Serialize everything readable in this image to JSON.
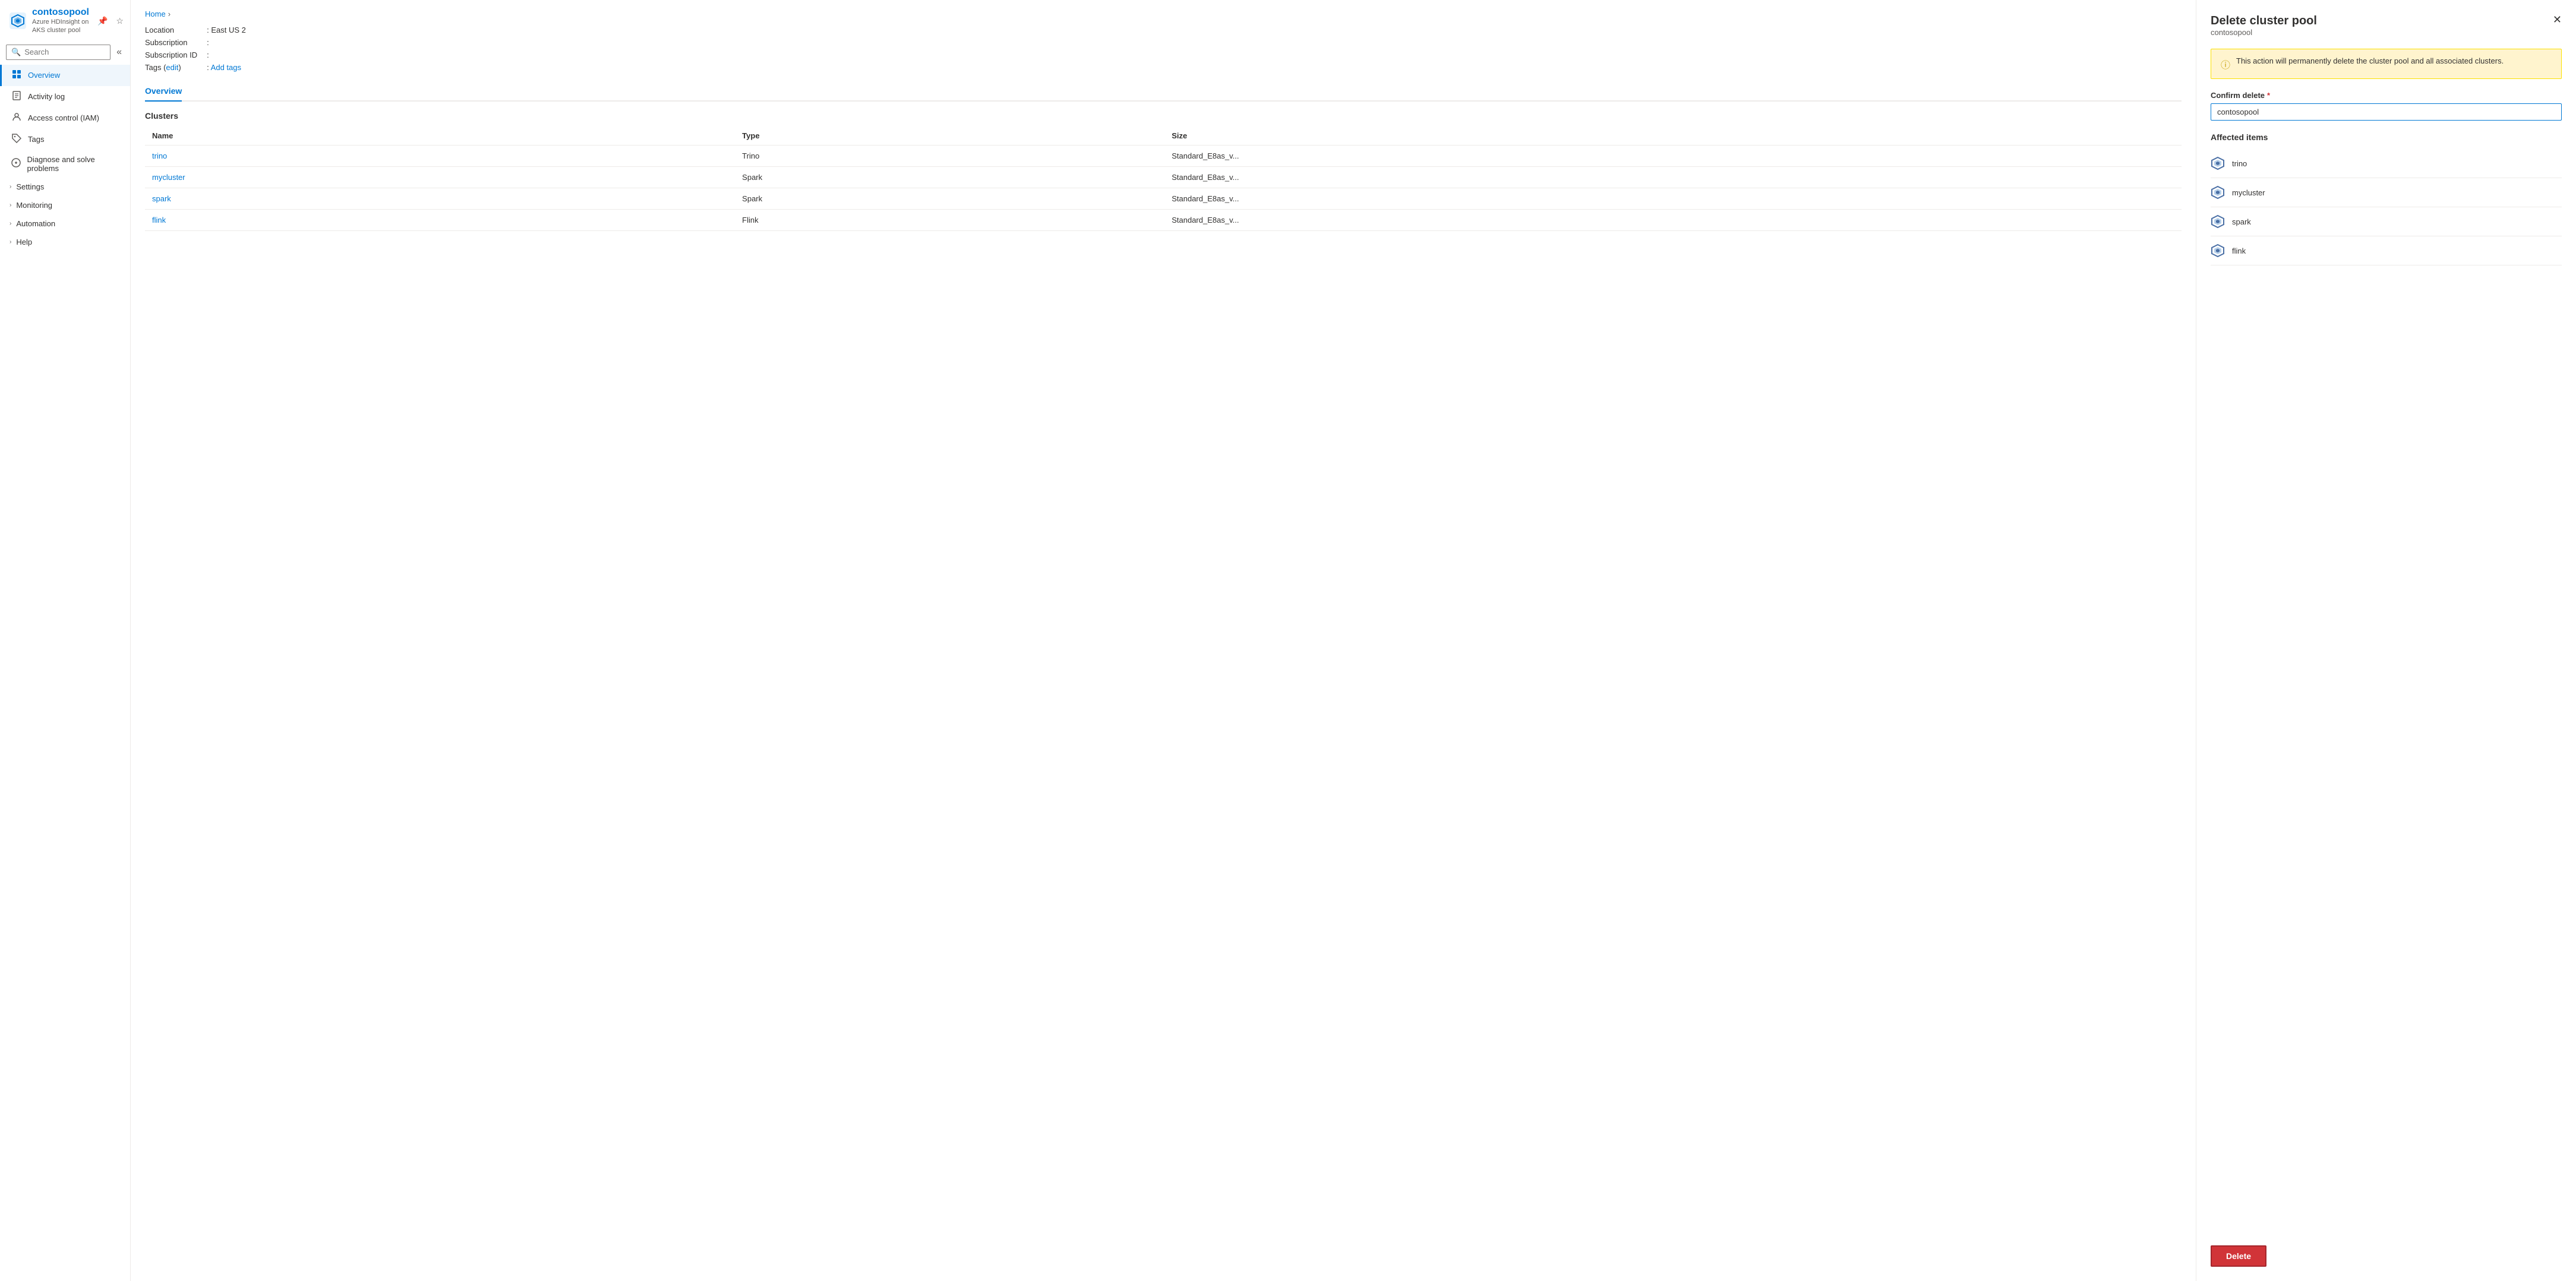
{
  "breadcrumb": {
    "home_label": "Home",
    "chevron": "›"
  },
  "sidebar": {
    "app_name": "contosopool",
    "app_subtitle": "Azure HDInsight on AKS cluster pool",
    "search_placeholder": "Search",
    "nav_items": [
      {
        "id": "overview",
        "label": "Overview",
        "icon": "⊞",
        "active": true,
        "expandable": false
      },
      {
        "id": "activity-log",
        "label": "Activity log",
        "icon": "📋",
        "active": false,
        "expandable": false
      },
      {
        "id": "access-control",
        "label": "Access control (IAM)",
        "icon": "👤",
        "active": false,
        "expandable": false
      },
      {
        "id": "tags",
        "label": "Tags",
        "icon": "🏷",
        "active": false,
        "expandable": false
      },
      {
        "id": "diagnose",
        "label": "Diagnose and solve problems",
        "icon": "🔧",
        "active": false,
        "expandable": false
      },
      {
        "id": "settings",
        "label": "Settings",
        "icon": "",
        "active": false,
        "expandable": true
      },
      {
        "id": "monitoring",
        "label": "Monitoring",
        "icon": "",
        "active": false,
        "expandable": true
      },
      {
        "id": "automation",
        "label": "Automation",
        "icon": "",
        "active": false,
        "expandable": true
      },
      {
        "id": "help",
        "label": "Help",
        "icon": "",
        "active": false,
        "expandable": true
      }
    ]
  },
  "main": {
    "location_label": "Location",
    "location_value": ": East US 2",
    "subscription_label": "Subscription",
    "subscription_value": ":",
    "subscription_id_label": "Subscription ID",
    "subscription_id_value": ":",
    "tags_label": "Tags (edit)",
    "tags_value": ": Add tags",
    "tab_label": "Overview",
    "clusters_section_title": "Clusters",
    "table_columns": [
      "Name",
      "Type",
      "Size"
    ],
    "clusters": [
      {
        "name": "trino",
        "type": "Trino",
        "size": "Standard_E8as_v..."
      },
      {
        "name": "mycluster",
        "type": "Spark",
        "size": "Standard_E8as_v..."
      },
      {
        "name": "spark",
        "type": "Spark",
        "size": "Standard_E8as_v..."
      },
      {
        "name": "flink",
        "type": "Flink",
        "size": "Standard_E8as_v..."
      }
    ]
  },
  "delete_panel": {
    "title": "Delete cluster pool",
    "subtitle": "contosopool",
    "warning_text": "This action will permanently delete the cluster pool and all associated clusters.",
    "confirm_label": "Confirm delete",
    "confirm_value": "contosopool",
    "affected_title": "Affected items",
    "affected_items": [
      {
        "name": "trino"
      },
      {
        "name": "mycluster"
      },
      {
        "name": "spark"
      },
      {
        "name": "flink"
      }
    ],
    "delete_button_label": "Delete"
  }
}
